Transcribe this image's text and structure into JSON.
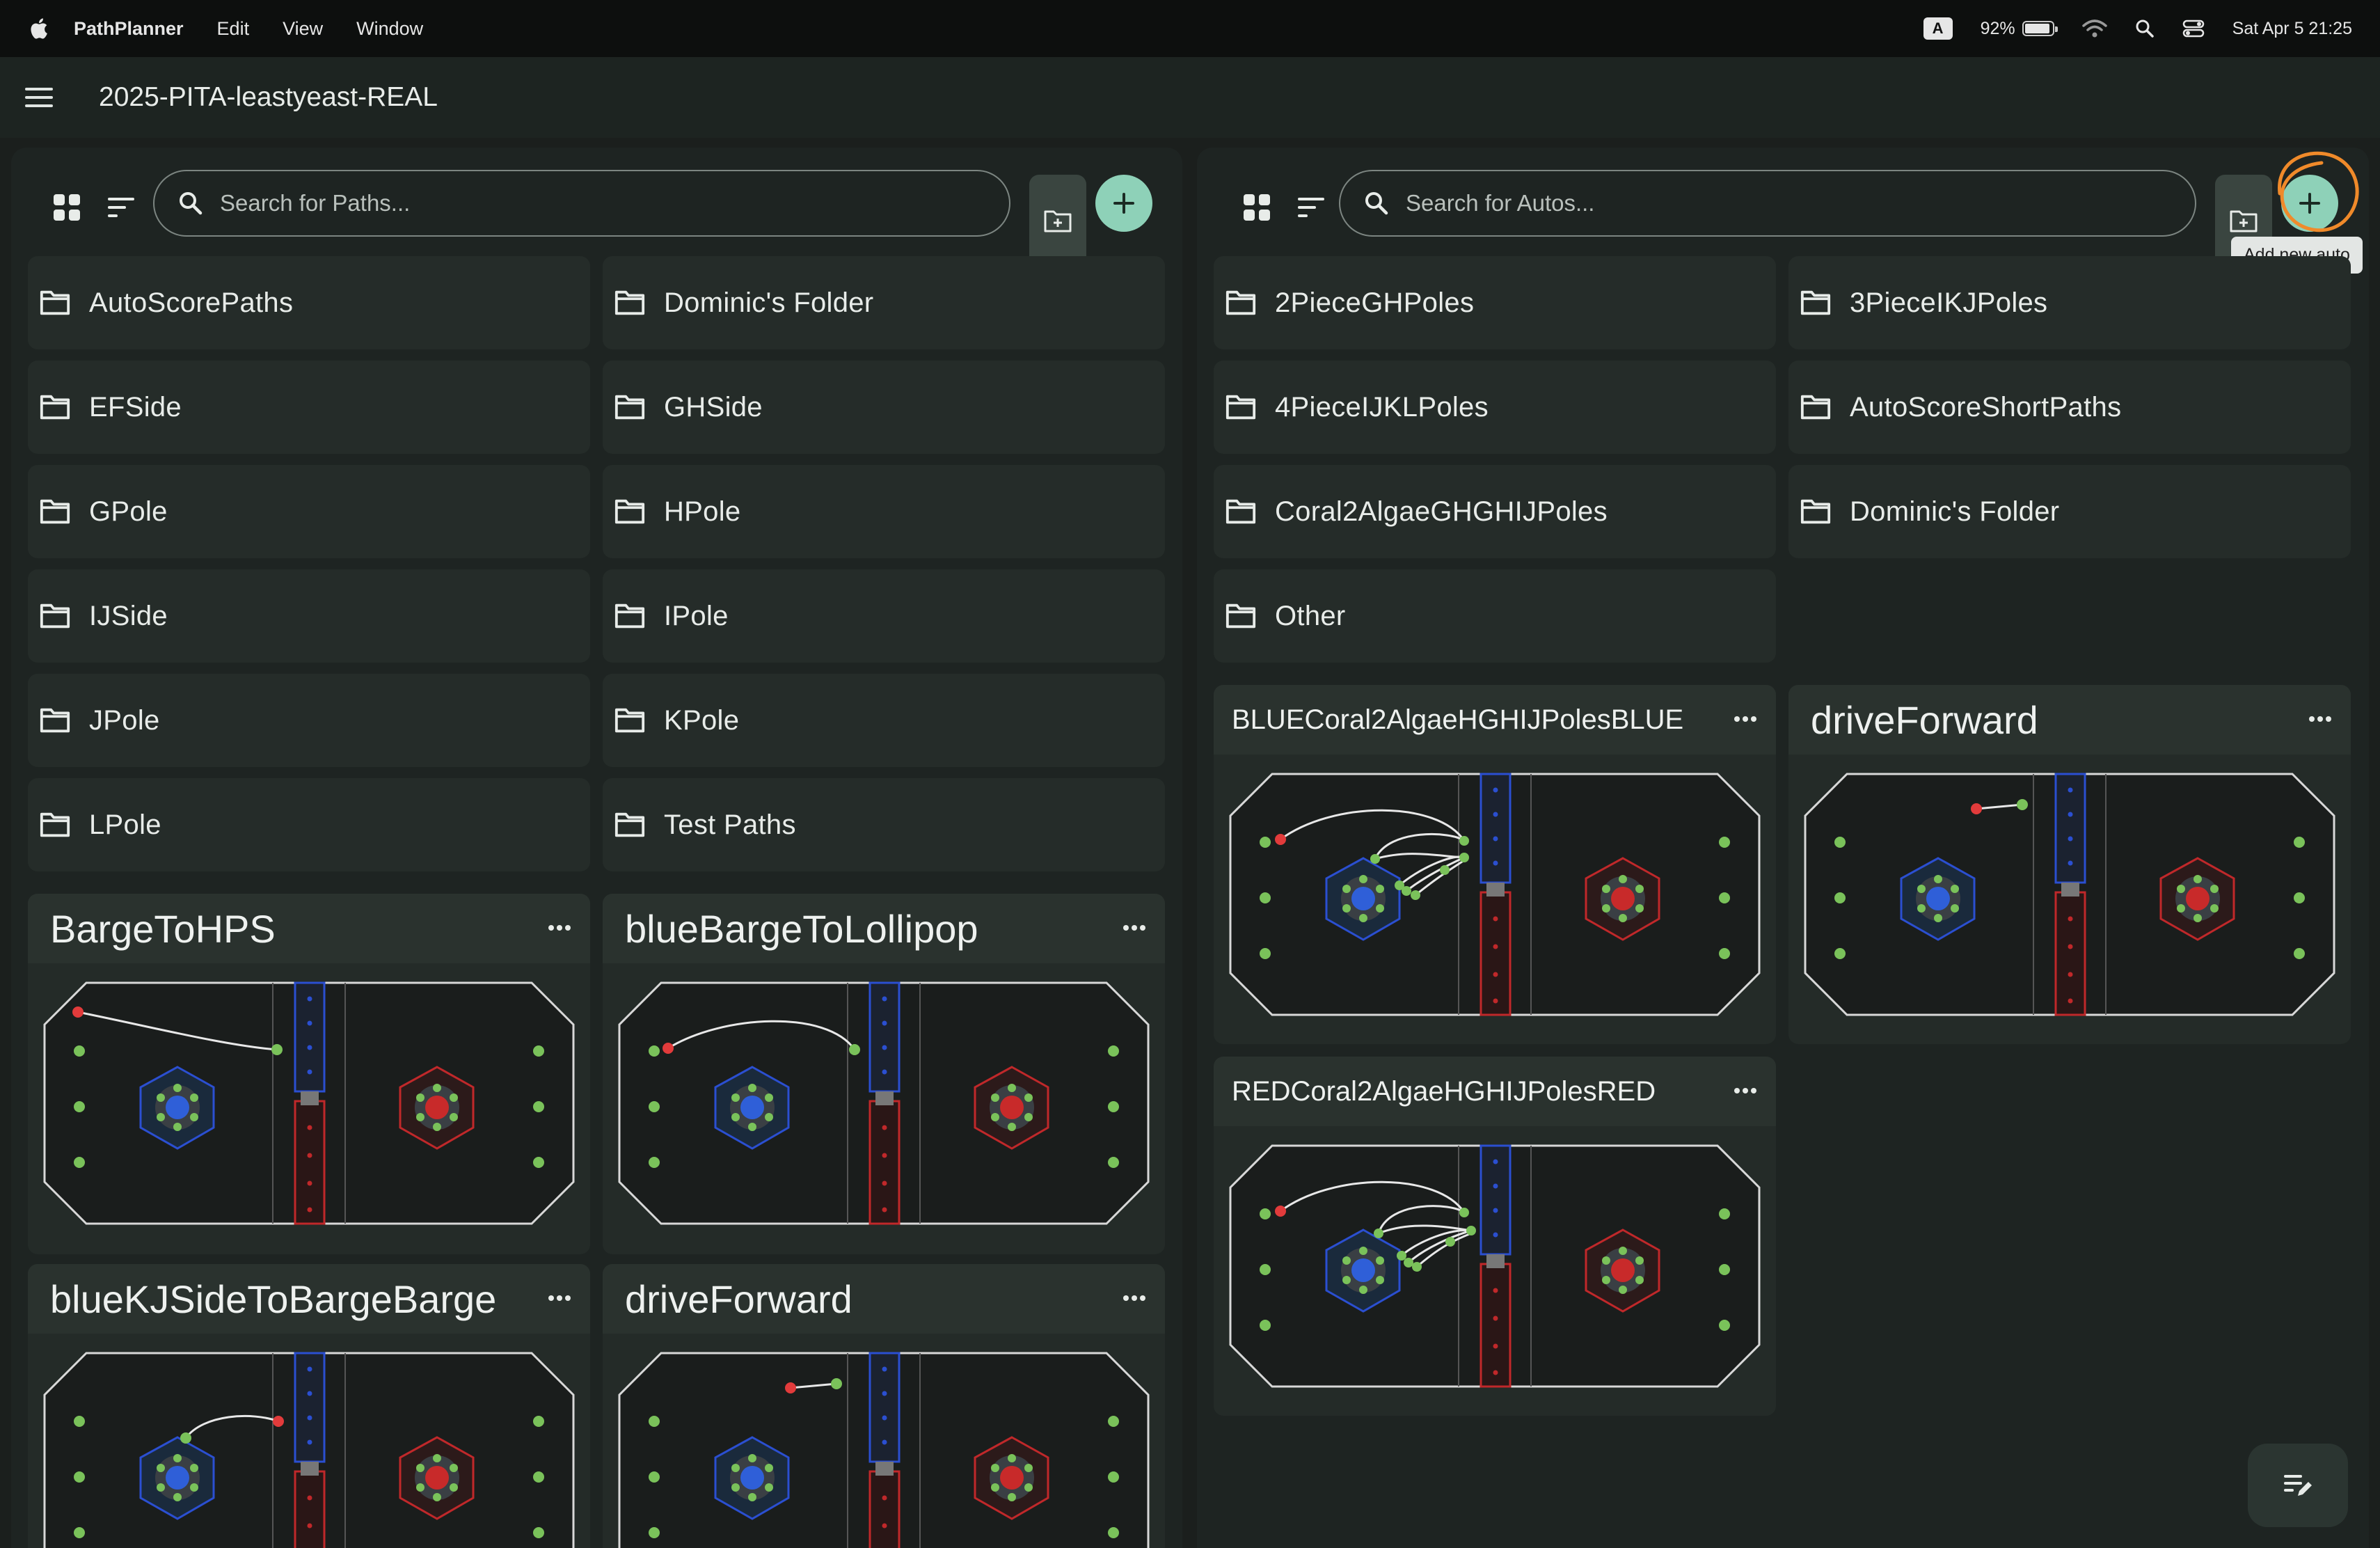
{
  "menubar": {
    "app": "PathPlanner",
    "items": [
      "Edit",
      "View",
      "Window"
    ],
    "input_source": "A",
    "battery": "92%",
    "battery_level": 0.92,
    "datetime": "Sat Apr 5  21:25"
  },
  "appbar": {
    "title": "2025-PITA-leastyeast-REAL"
  },
  "paths_panel": {
    "search_placeholder": "Search for Paths...",
    "folders": [
      "AutoScorePaths",
      "Dominic's Folder",
      "EFSide",
      "GHSide",
      "GPole",
      "HPole",
      "IJSide",
      "IPole",
      "JPole",
      "KPole",
      "LPole",
      "Test Paths"
    ],
    "cards": [
      "BargeToHPS",
      "blueBargeToLollipop",
      "blueKJSideToBargeBarge",
      "driveForward"
    ]
  },
  "autos_panel": {
    "search_placeholder": "Search for Autos...",
    "add_tooltip": "Add new auto",
    "folders": [
      "2PieceGHPoles",
      "3PieceIKJPoles",
      "4PieceIJKLPoles",
      "AutoScoreShortPaths",
      "Coral2AlgaeGHGHIJPoles",
      "Dominic's Folder",
      "Other"
    ],
    "cards": [
      "BLUECoral2AlgaeHGHIJPolesBLUE",
      "driveForward",
      "REDCoral2AlgaeHGHIJPolesRED"
    ]
  },
  "colors": {
    "accent": "#8ed1b8",
    "background": "#1b1f1d",
    "panel": "#1e2422",
    "annotation": "#f08a2a"
  },
  "icons": [
    "apple-icon",
    "wifi-icon",
    "spotlight-search-icon",
    "control-center-icon",
    "hamburger-menu-icon",
    "grid-view-icon",
    "sort-icon",
    "search-icon",
    "new-folder-icon",
    "add-icon",
    "folder-icon",
    "more-options-icon",
    "edit-notes-icon"
  ]
}
